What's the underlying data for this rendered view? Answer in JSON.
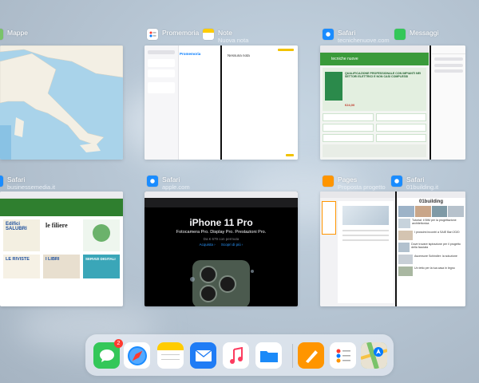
{
  "switcher": {
    "cards": [
      {
        "id": "maps",
        "title": "Mappe",
        "subtitle": ""
      },
      {
        "id": "notes_split",
        "title": "Promemoria",
        "title2": "Note",
        "subtitle2": "Nuova nota"
      },
      {
        "id": "safari_msg",
        "title": "Safari",
        "subtitle": "tecnichenuove.com",
        "title2": "Messaggi"
      },
      {
        "id": "safari_bm",
        "title": "Safari",
        "subtitle": "businessemedia.it"
      },
      {
        "id": "safari_apple",
        "title": "Safari",
        "subtitle": "apple.com"
      },
      {
        "id": "pages_safari",
        "title": "Pages",
        "subtitle": "Proposta progetto",
        "title2": "Safari",
        "subtitle2": "01building.it"
      }
    ],
    "notes_split_content": {
      "list_title": "Promemoria",
      "right_title": "Nessuna nota"
    },
    "safari_tn_content": {
      "site_name": "tecniche nuove",
      "headline": "QUALIFICAZIONE PROFESSIONALE CON IMPIANTI NEI SETTORI ELETTRICI E NON CASI COMPLESSI",
      "price": "€24,00"
    },
    "apple_content": {
      "headline": "iPhone 11 Pro",
      "tagline": "Fotocamera Pro. Display Pro. Prestazioni Pro.",
      "price_line": "Da € 679 con permuta",
      "link1": "Acquista ›",
      "link2": "Scopri di più ›"
    },
    "bm_content": {
      "tile1": "Edifici SALUBRI",
      "tile2": "le filiere",
      "tile4": "LE RIVISTE",
      "tile5": "I LIBRI",
      "tile6": "SERVIZI DIGITALI"
    },
    "building_content": {
      "logo": "01building",
      "item1": "Tutorial: il BIM per la progettazione architettonica",
      "item2": "I prossimi incontri a SAIE Bari 2020",
      "item3": "Dove trovare ispirazione per il progetto della facciata",
      "item4": "Ascensore Schindler: la soluzione",
      "item5": "Un tetto per la tua casa in legno"
    }
  },
  "dock": {
    "apps": [
      {
        "name": "Messaggi",
        "badge": "2",
        "color": "#34c759"
      },
      {
        "name": "Safari",
        "color": "#1a8cff"
      },
      {
        "name": "Note",
        "color": "#ffcc00"
      },
      {
        "name": "Mail",
        "color": "#1f7cf5"
      },
      {
        "name": "Musica",
        "color": "#fc3c5f"
      },
      {
        "name": "File",
        "color": "#1b8af8"
      },
      {
        "name": "Pages",
        "color": "#ff9500"
      },
      {
        "name": "Promemoria",
        "color": "#ffffff"
      },
      {
        "name": "Mappe",
        "color": "#7ac36a"
      }
    ]
  }
}
